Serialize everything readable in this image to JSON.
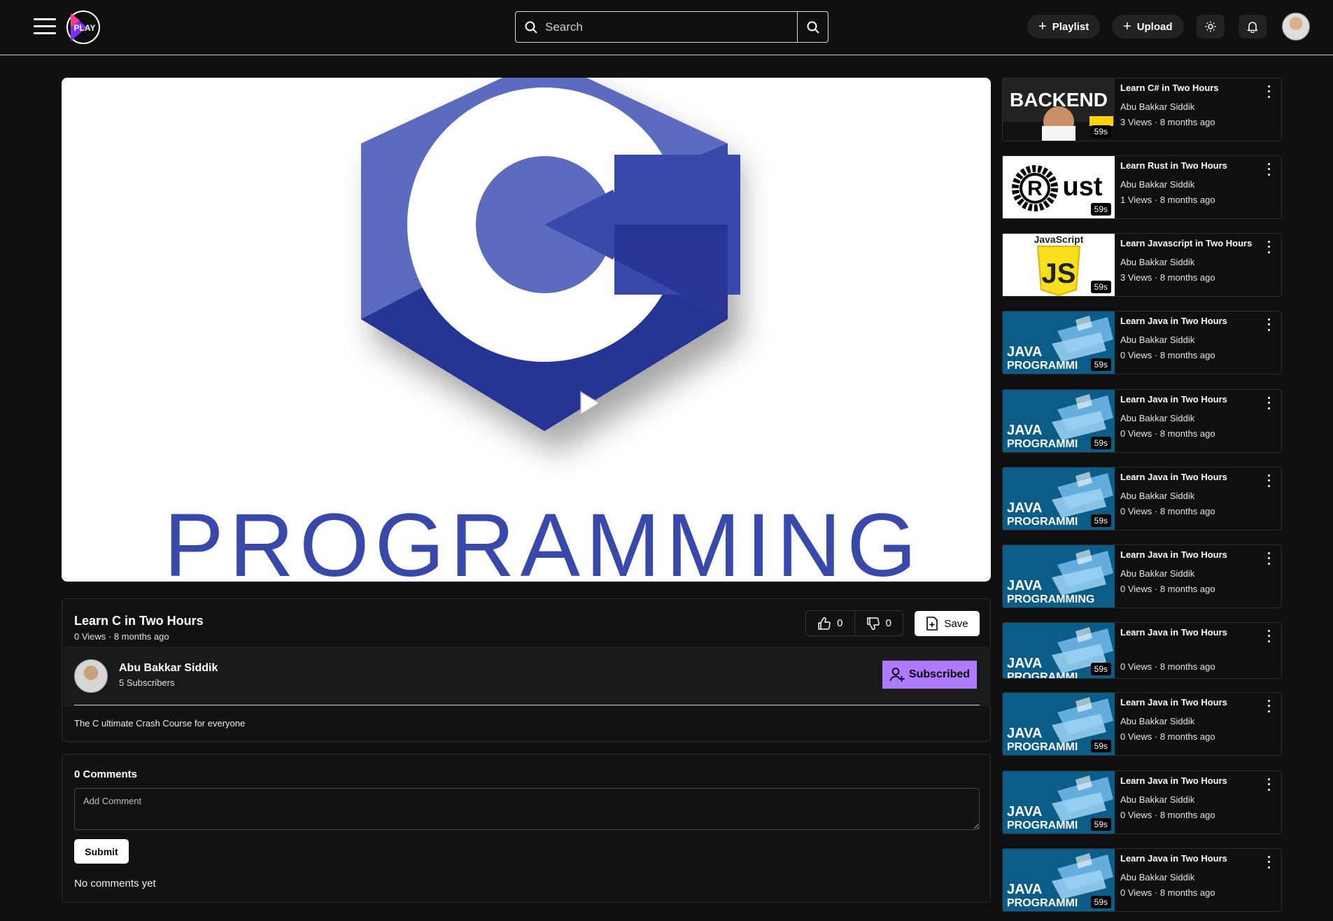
{
  "header": {
    "logo_text": "PLAY",
    "search_placeholder": "Search",
    "playlist_label": "Playlist",
    "upload_label": "Upload"
  },
  "video": {
    "thumbnail_word": "PROGRAMMING",
    "title": "Learn C in Two Hours",
    "meta": "0 Views · 8 months ago",
    "likes": "0",
    "dislikes": "0",
    "save_label": "Save",
    "description": "The C ultimate Crash Course for everyone"
  },
  "channel": {
    "name": "Abu Bakkar Siddik",
    "subscribers": "5 Subscribers",
    "subscribe_label": "Subscribed"
  },
  "comments": {
    "title": "0 Comments",
    "input_placeholder": "Add Comment",
    "submit_label": "Submit",
    "empty_text": "No comments yet"
  },
  "related": [
    {
      "title": "Learn C# in Two Hours",
      "channel": "Abu Bakkar Siddik",
      "meta": "3 Views · 8 months ago",
      "duration": "59s",
      "thumb": "backend",
      "thumb_text": "BACKEND"
    },
    {
      "title": "Learn Rust in Two Hours",
      "channel": "Abu Bakkar Siddik",
      "meta": "1 Views · 8 months ago",
      "duration": "59s",
      "thumb": "rust",
      "thumb_text": "ust"
    },
    {
      "title": "Learn Javascript in Two Hours",
      "channel": "Abu Bakkar Siddik",
      "meta": "3 Views · 8 months ago",
      "duration": "59s",
      "thumb": "js",
      "thumb_text": "JavaScript"
    },
    {
      "title": "Learn Java in Two Hours",
      "channel": "Abu Bakkar Siddik",
      "meta": "0 Views · 8 months ago",
      "duration": "59s",
      "thumb": "java",
      "thumb_text": "PROGRAMMI"
    },
    {
      "title": "Learn Java in Two Hours",
      "channel": "Abu Bakkar Siddik",
      "meta": "0 Views · 8 months ago",
      "duration": "59s",
      "thumb": "java",
      "thumb_text": "PROGRAMMI"
    },
    {
      "title": "Learn Java in Two Hours",
      "channel": "Abu Bakkar Siddik",
      "meta": "0 Views · 8 months ago",
      "duration": "59s",
      "thumb": "java",
      "thumb_text": "PROGRAMMI"
    },
    {
      "title": "Learn Java in Two Hours",
      "channel": "Abu Bakkar Siddik",
      "meta": "0 Views · 8 months ago",
      "duration": "",
      "thumb": "java",
      "thumb_text": "PROGRAMMING"
    },
    {
      "title": "Learn Java in Two Hours",
      "channel": "",
      "meta": "0 Views · 8 months ago",
      "duration": "59s",
      "thumb": "java",
      "thumb_text": "PROGRAMMI"
    },
    {
      "title": "Learn Java in Two Hours",
      "channel": "Abu Bakkar Siddik",
      "meta": "0 Views · 8 months ago",
      "duration": "59s",
      "thumb": "java",
      "thumb_text": "PROGRAMMI"
    },
    {
      "title": "Learn Java in Two Hours",
      "channel": "Abu Bakkar Siddik",
      "meta": "0 Views · 8 months ago",
      "duration": "59s",
      "thumb": "java",
      "thumb_text": "PROGRAMMI"
    },
    {
      "title": "Learn Java in Two Hours",
      "channel": "Abu Bakkar Siddik",
      "meta": "0 Views · 8 months ago",
      "duration": "59s",
      "thumb": "java",
      "thumb_text": "PROGRAMMI"
    }
  ],
  "colors": {
    "background": "#0f0f0f",
    "accent": "#ae7aff",
    "c_logo_blue": "#3949ab"
  }
}
